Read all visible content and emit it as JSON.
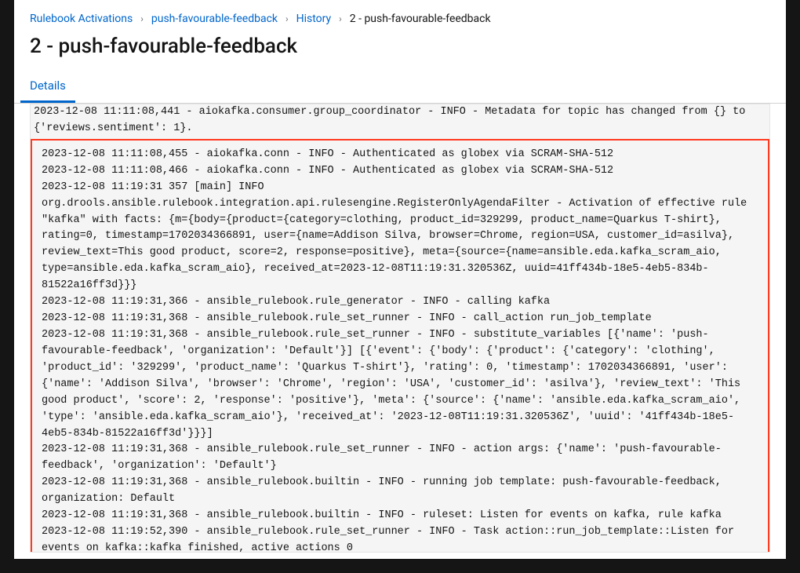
{
  "breadcrumb": {
    "items": [
      {
        "label": "Rulebook Activations"
      },
      {
        "label": "push-favourable-feedback"
      },
      {
        "label": "History"
      }
    ],
    "current": "2 - push-favourable-feedback"
  },
  "page": {
    "title": "2 - push-favourable-feedback"
  },
  "tabs": {
    "details": "Details"
  },
  "log": {
    "prelog": "2023-12-08 11:11:08,441 - aiokafka.consumer.group_coordinator - INFO - Metadata for topic has changed from {} to {'reviews.sentiment': 1}.",
    "highlighted": "2023-12-08 11:11:08,455 - aiokafka.conn - INFO - Authenticated as globex via SCRAM-SHA-512\n2023-12-08 11:11:08,466 - aiokafka.conn - INFO - Authenticated as globex via SCRAM-SHA-512\n2023-12-08 11:19:31 357 [main] INFO org.drools.ansible.rulebook.integration.api.rulesengine.RegisterOnlyAgendaFilter - Activation of effective rule \"kafka\" with facts: {m={body={product={category=clothing, product_id=329299, product_name=Quarkus T-shirt}, rating=0, timestamp=1702034366891, user={name=Addison Silva, browser=Chrome, region=USA, customer_id=asilva}, review_text=This good product, score=2, response=positive}, meta={source={name=ansible.eda.kafka_scram_aio, type=ansible.eda.kafka_scram_aio}, received_at=2023-12-08T11:19:31.320536Z, uuid=41ff434b-18e5-4eb5-834b-81522a16ff3d}}}\n2023-12-08 11:19:31,366 - ansible_rulebook.rule_generator - INFO - calling kafka\n2023-12-08 11:19:31,368 - ansible_rulebook.rule_set_runner - INFO - call_action run_job_template\n2023-12-08 11:19:31,368 - ansible_rulebook.rule_set_runner - INFO - substitute_variables [{'name': 'push-favourable-feedback', 'organization': 'Default'}] [{'event': {'body': {'product': {'category': 'clothing', 'product_id': '329299', 'product_name': 'Quarkus T-shirt'}, 'rating': 0, 'timestamp': 1702034366891, 'user': {'name': 'Addison Silva', 'browser': 'Chrome', 'region': 'USA', 'customer_id': 'asilva'}, 'review_text': 'This good product', 'score': 2, 'response': 'positive'}, 'meta': {'source': {'name': 'ansible.eda.kafka_scram_aio', 'type': 'ansible.eda.kafka_scram_aio'}, 'received_at': '2023-12-08T11:19:31.320536Z', 'uuid': '41ff434b-18e5-4eb5-834b-81522a16ff3d'}}}]\n2023-12-08 11:19:31,368 - ansible_rulebook.rule_set_runner - INFO - action args: {'name': 'push-favourable-feedback', 'organization': 'Default'}\n2023-12-08 11:19:31,368 - ansible_rulebook.builtin - INFO - running job template: push-favourable-feedback, organization: Default\n2023-12-08 11:19:31,368 - ansible_rulebook.builtin - INFO - ruleset: Listen for events on kafka, rule kafka\n2023-12-08 11:19:52,390 - ansible_rulebook.rule_set_runner - INFO - Task action::run_job_template::Listen for events on kafka::kafka finished, active actions 0"
  }
}
